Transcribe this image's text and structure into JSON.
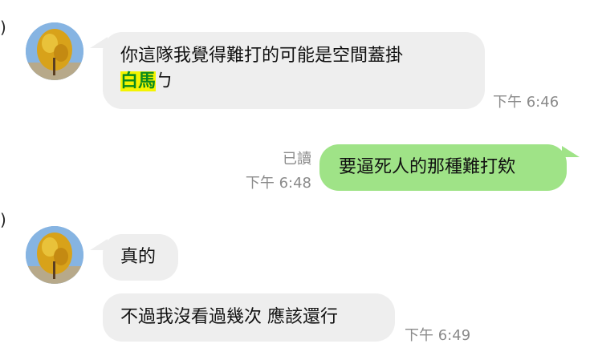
{
  "edge_fragments": {
    "top": ")",
    "bottom": ")"
  },
  "messages": [
    {
      "direction": "incoming",
      "text_line1": "你這隊我覺得難打的可能是空間蓋掛",
      "highlight": "白馬",
      "text_line2_suffix": "ㄅ",
      "time": "下午 6:46"
    },
    {
      "direction": "outgoing",
      "read_status": "已讀",
      "text": "要逼死人的那種難打欸",
      "time": "下午 6:48"
    },
    {
      "direction": "incoming",
      "text": "真的"
    },
    {
      "direction": "incoming",
      "text": "不過我沒看過幾次 應該還行",
      "time": "下午 6:49"
    }
  ],
  "colors": {
    "incoming_bubble": "#eeeeee",
    "outgoing_bubble": "#9fe387",
    "highlight_bg": "#f4f400",
    "highlight_text": "#0a8a1e",
    "meta_text": "#8a8a8a"
  },
  "icons": {
    "avatar": "ginkgo-tree-avatar"
  }
}
